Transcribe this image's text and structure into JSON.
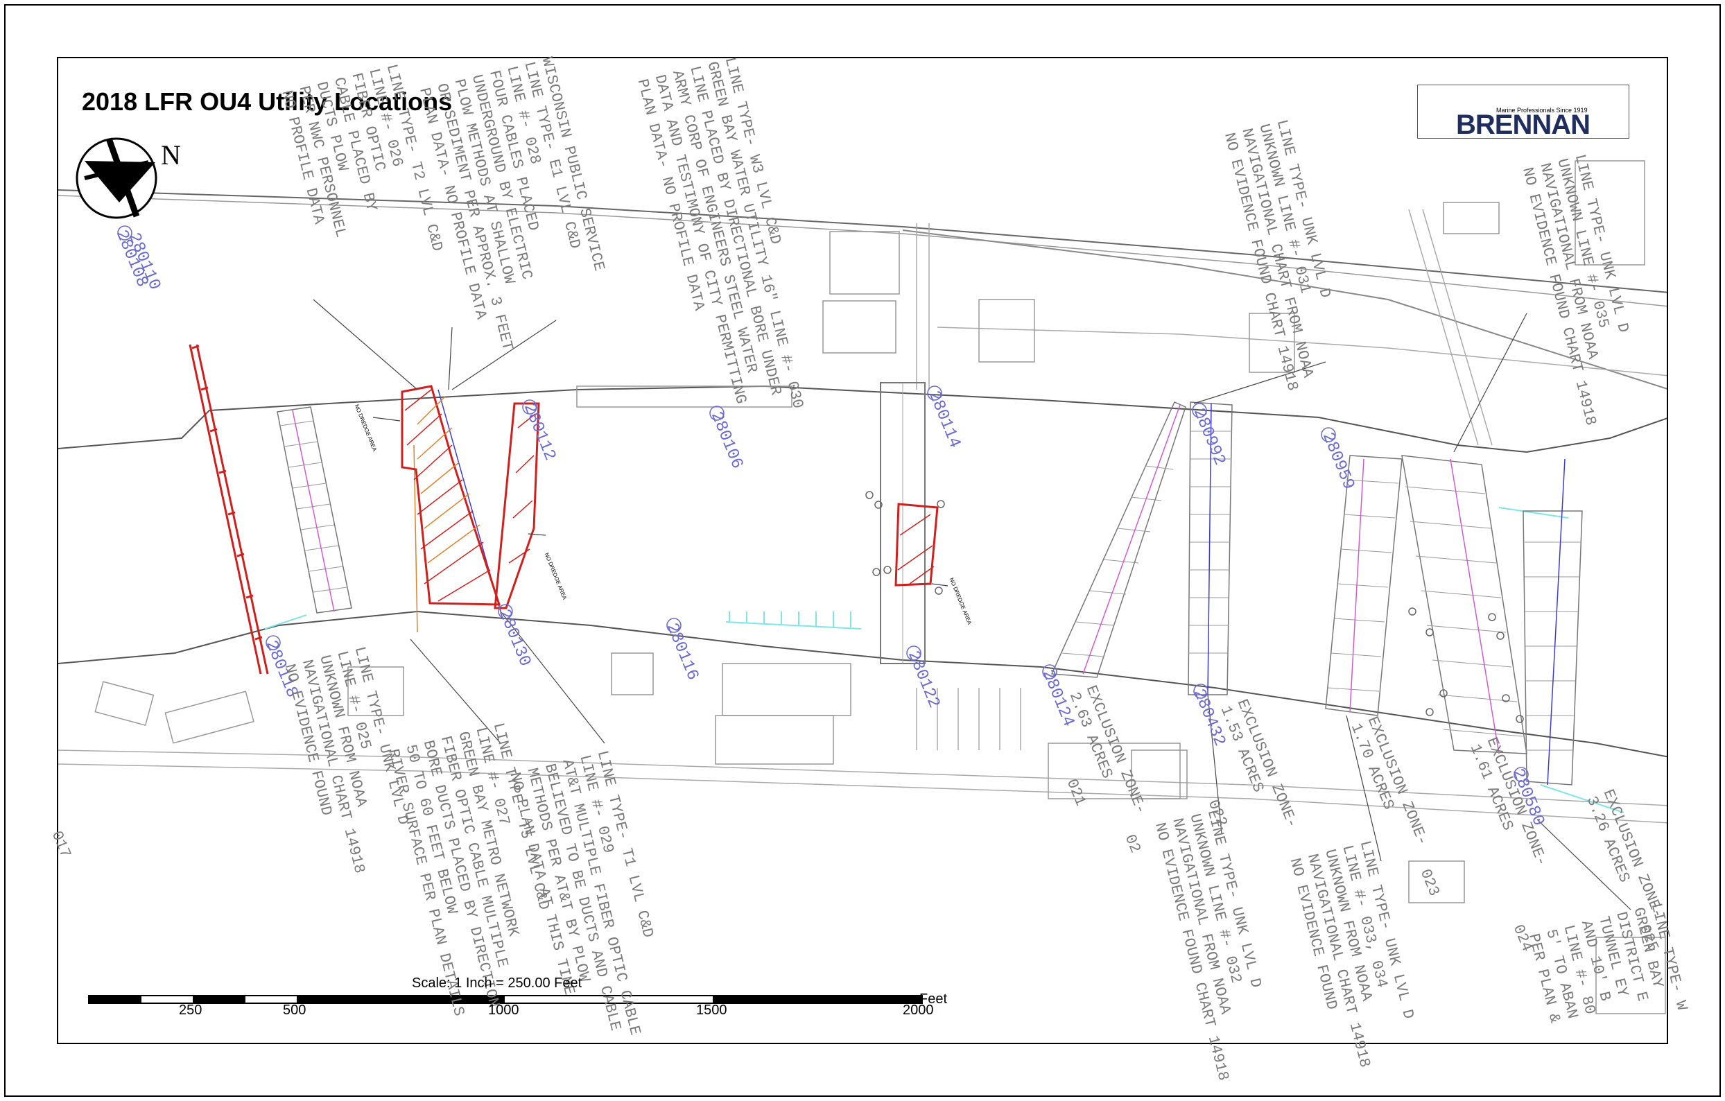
{
  "title": "2018 LFR OU4 Utility Locations",
  "north_arrow": {
    "label": "N",
    "icon": "north-arrow-icon"
  },
  "logo": {
    "name": "BRENNAN",
    "tagline": "Marine Professionals Since 1919",
    "colors": [
      "#c8102e",
      "#1f2d5e",
      "#1a8a3c"
    ]
  },
  "scale_bar": {
    "caption": "Scale: 1 Inch = 250.00 Feet",
    "ticks": [
      "250",
      "500",
      "1000",
      "1500",
      "2000"
    ],
    "unit": "Feet"
  },
  "structure_labels": [
    "280108",
    "280110",
    "280112",
    "280106",
    "280114",
    "280992",
    "280959",
    "280118",
    "280130",
    "280116",
    "280122",
    "280124",
    "280432",
    "280580",
    "017"
  ],
  "no_dredge_labels": [
    "NO DREDGE AREA",
    "NO DREDGE AREA",
    "NO DREDGE AREA"
  ],
  "callouts": [
    "LINE TYPE- T2 LVL C&D\nLINE #- 026\nFIBER OPTIC\nCABLE PLACED BY\nDUCTS PLOW\nPER NWC PERSONNEL\nNO PROFILE DATA",
    "WISCONSIN PUBLIC SERVICE\nLINE TYPE- E1 LVL C&D\nLINE #- 028\nFOUR CABLES PLACED\nUNDERGROUND BY ELECTRIC\nPLOW METHODS AT SHALLOW\nOR SEDIMENT PER APPROX. 3 FEET\nPLAN DATA- NO PROFILE DATA",
    "LINE TYPE- W3 LVL C&D\nGREEN BAY WATER UTILITY 16\" LINE #- 030\nLINE PLACED BY DIRECTIONAL BORE UNDER\nARMY CORP OF ENGINEERS STEEL WATER\nDATA AND TESTIMONY OF CITY PERMITTING\nPLAN DATA- NO PROFILE DATA",
    "LINE TYPE- UNK LVL D\nUNKNOWN LINE #- 031\nNAVIGATIONAL CHART FROM NOAA\nNO EVIDENCE FOUND CHART 14918",
    "LINE TYPE- UNK LVL D\nUNKNOWN LINE #- 035\nNAVIGATIONAL FROM NOAA\nNO EVIDENCE FOUND CHART 14918",
    "LINE TYPE- UNK LVL D\nLINE #- 025\nUNKNOWN FROM NOAA\nNAVIGATIONAL CHART 14918\nNO EVIDENCE FOUND",
    "LINE TYPE- T5 LVL C&D\nLINE #- 027\nGREEN BAY METRO NETWORK\nFIBER OPTIC CABLE MULTIPLE\nBORE DUCTS PLACED BY DIRECTION\n50 TO 60 FEET BELOW\nRIVER SURFACE PER PLAN DETAILS",
    "LINE TYPE- T1 LVL C&D\nLINE #- 029\nAT&T MULTIPLE FIBER OPTIC CABLE\nBELIEVED TO BE DUCTS AND CABLE\nMETHODS PER AT&T BY PLOW\nNO PLAN DATA AT THIS TIME",
    "LINE TYPE- UNK LVL D\nUNKNOWN LINE #- 032\nNAVIGATIONAL FROM NOAA\nNO EVIDENCE FOUND CHART 14918",
    "LINE TYPE- UNK LVL D\nLINE #- 033, 034\nUNKNOWN FROM NOAA\nNAVIGATIONAL CHART 14918\nNO EVIDENCE FOUND",
    "LINE TYPE- W\nGREEN BAY\nDISTRICT E\nTUNNEL EY\nAND 10' B\nLINE #- 80\n5' TO ABAN\nPER PLAN &"
  ],
  "exclusion_labels": [
    "EXCLUSION ZONE-\n2.63 ACRES",
    "EXCLUSION ZONE-\n1.53 ACRES",
    "EXCLUSION ZONE-\n1.70 ACRES",
    "EXCLUSION ZONE-\n1.61 ACRES",
    "EXCLUSION ZONE-\n3.26 ACRES"
  ],
  "zone_numbers": [
    "02",
    "021",
    "022",
    "023",
    "024",
    "025"
  ],
  "colors": {
    "utility_red": "#d0201d",
    "hatch_orange": "#e0822a",
    "gray_linework": "#8a8a8a",
    "dock_cyan": "#7fe6e6",
    "label_blue": "#6b6bd0",
    "pipeline_magenta": "#d15bd1",
    "pipeline_blue": "#3b3bd6"
  }
}
